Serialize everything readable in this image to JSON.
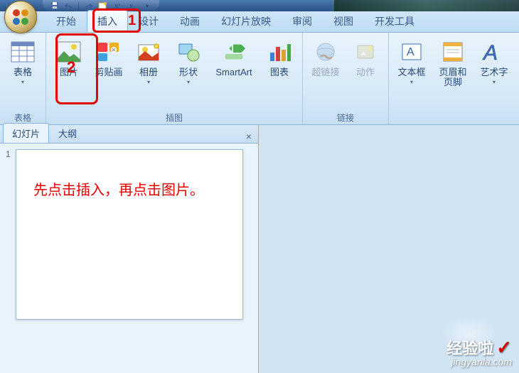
{
  "qat": {
    "save_icon": "save-icon",
    "undo_icon": "undo-icon",
    "redo_icon": "redo-icon",
    "new_icon": "new-icon",
    "sub_icon": "subscript-icon",
    "sub2_icon": "subscript2-icon"
  },
  "tabs": {
    "items": [
      {
        "label": "开始"
      },
      {
        "label": "插入"
      },
      {
        "label": "设计"
      },
      {
        "label": "动画"
      },
      {
        "label": "幻灯片放映"
      },
      {
        "label": "审阅"
      },
      {
        "label": "视图"
      },
      {
        "label": "开发工具"
      }
    ],
    "active_index": 1
  },
  "annotations": {
    "a1": "1",
    "a2": "2"
  },
  "ribbon": {
    "groups": [
      {
        "label": "表格",
        "buttons": [
          {
            "label": "表格",
            "icon": "table-icon",
            "arrow": true
          }
        ]
      },
      {
        "label": "插图",
        "buttons": [
          {
            "label": "图片",
            "icon": "picture-icon"
          },
          {
            "label": "剪贴画",
            "icon": "clipart-icon"
          },
          {
            "label": "相册",
            "icon": "album-icon",
            "arrow": true
          },
          {
            "label": "形状",
            "icon": "shapes-icon",
            "arrow": true
          },
          {
            "label": "SmartArt",
            "icon": "smartart-icon"
          },
          {
            "label": "图表",
            "icon": "chart-icon"
          }
        ]
      },
      {
        "label": "链接",
        "buttons": [
          {
            "label": "超链接",
            "icon": "hyperlink-icon",
            "disabled": true
          },
          {
            "label": "动作",
            "icon": "action-icon",
            "disabled": true
          }
        ]
      },
      {
        "label": "",
        "buttons": [
          {
            "label": "文本框",
            "icon": "textbox-icon",
            "arrow": true
          },
          {
            "label": "页眉和页脚",
            "icon": "header-footer-icon",
            "wrap": true
          },
          {
            "label": "艺术字",
            "icon": "wordart-icon",
            "arrow": true
          }
        ]
      }
    ]
  },
  "sidepanel": {
    "tabs": [
      {
        "label": "幻灯片"
      },
      {
        "label": "大纲"
      }
    ],
    "active_index": 0,
    "slides": [
      {
        "num": "1",
        "text": "先点击插入，再点击图片。"
      }
    ]
  },
  "watermark": {
    "line1": "经验啦",
    "line2": "jingyanla.com"
  }
}
